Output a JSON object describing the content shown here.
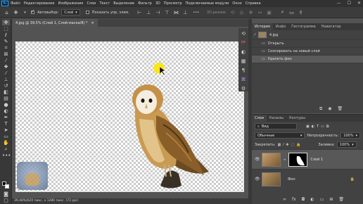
{
  "menubar": {
    "logo": "Ps",
    "items": [
      "Файл",
      "Редактирование",
      "Изображение",
      "Слои",
      "Текст",
      "Выделение",
      "Фильтр",
      "3D",
      "Просмотр",
      "Подключаемые модули",
      "Окно",
      "Справка"
    ],
    "window_controls": [
      "—",
      "☐",
      "✕"
    ]
  },
  "options": {
    "autoselect_label": "Автовыбор:",
    "autoselect_value": "Слой",
    "show_controls_label": "Показать упр. элем.",
    "mode3d_label": "3D-режим:",
    "more": "•••"
  },
  "document": {
    "tab_title": "4.jpg @ 39,5% (Слой 1, Слой-маска/8) *",
    "close": "✕"
  },
  "status": "39,48%|620 пикс. x 1280 пикс. (72 ppi)",
  "history_panel": {
    "tabs": [
      "История",
      "Инфо",
      "Гистограмма",
      "Навигатор"
    ],
    "snapshot": "4.jpg",
    "items": [
      "Открыть",
      "Скопировать на новый слой",
      "Удалить фон"
    ]
  },
  "layers_panel": {
    "tabs": [
      "Слои",
      "Каналы",
      "Контуры"
    ],
    "filter_label": "Вид",
    "blend_mode": "Обычные",
    "opacity_label": "Непрозрачность:",
    "opacity_value": "100%",
    "lock_label": "Закрепить:",
    "fill_label": "Заливка:",
    "fill_value": "100%",
    "layers": [
      {
        "name": "Слой 1",
        "selected": true
      },
      {
        "name": "Фон",
        "selected": false
      }
    ]
  },
  "colors": {
    "accent": "#31a8ff",
    "highlight_cursor": "#ffe600"
  }
}
